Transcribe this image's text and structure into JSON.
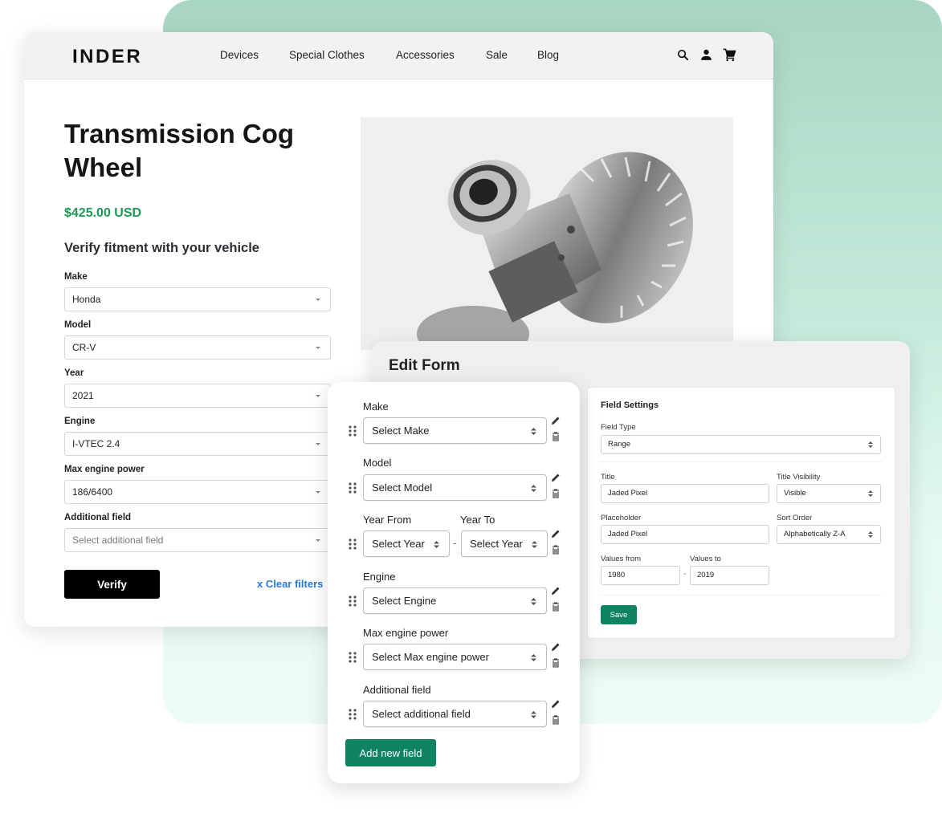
{
  "store": {
    "logo": "INDER",
    "nav": [
      "Devices",
      "Special Clothes",
      "Accessories",
      "Sale",
      "Blog"
    ],
    "icons": [
      "search-icon",
      "account-icon",
      "cart-icon"
    ],
    "product": {
      "title": "Transmission Cog Wheel",
      "price": "$425.00 USD",
      "image": "differential-gear-image"
    },
    "fitment": {
      "heading": "Verify fitment with your vehicle",
      "fields": [
        {
          "label": "Make",
          "value": "Honda",
          "placeholder": false
        },
        {
          "label": "Model",
          "value": "CR-V",
          "placeholder": false
        },
        {
          "label": "Year",
          "value": "2021",
          "placeholder": false
        },
        {
          "label": "Engine",
          "value": "I-VTEC 2.4",
          "placeholder": false
        },
        {
          "label": "Max engine power",
          "value": "186/6400",
          "placeholder": false
        },
        {
          "label": "Additional field",
          "value": "Select additional field",
          "placeholder": true
        }
      ],
      "verify_label": "Verify",
      "clear_label": "x Clear filters"
    }
  },
  "edit_form": {
    "title": "Edit Form",
    "builder": {
      "fields": [
        {
          "label": "Make",
          "select": "Select Make"
        },
        {
          "label": "Model",
          "select": "Select Model"
        },
        {
          "label": "Year From",
          "label2": "Year To",
          "select": "Select Year",
          "select2": "Select Year",
          "range": true
        },
        {
          "label": "Engine",
          "select": "Select Engine"
        },
        {
          "label": "Max engine power",
          "select": "Select Max engine power"
        },
        {
          "label": "Additional field",
          "select": "Select additional field"
        }
      ],
      "add_label": "Add new field",
      "range_separator": "-"
    },
    "settings": {
      "title": "Field Settings",
      "field_type_label": "Field Type",
      "field_type_value": "Range",
      "title_label": "Title",
      "title_value": "Jaded Pixel",
      "title_visibility_label": "Title Visibility",
      "title_visibility_value": "Visible",
      "placeholder_label": "Placeholder",
      "placeholder_value": "Jaded Pixel",
      "sort_order_label": "Sort Order",
      "sort_order_value": "Alphabetically Z-A",
      "values_from_label": "Values from",
      "values_from": "1980",
      "values_to_label": "Values to",
      "values_to": "2019",
      "range_separator": "-",
      "save_label": "Save"
    }
  },
  "colors": {
    "accent_green": "#0e8462",
    "price_green": "#1a9a52",
    "link_blue": "#2d7bd0",
    "bg_mint_top": "#a8d6c3",
    "bg_mint_bottom": "#ebfcf4"
  }
}
